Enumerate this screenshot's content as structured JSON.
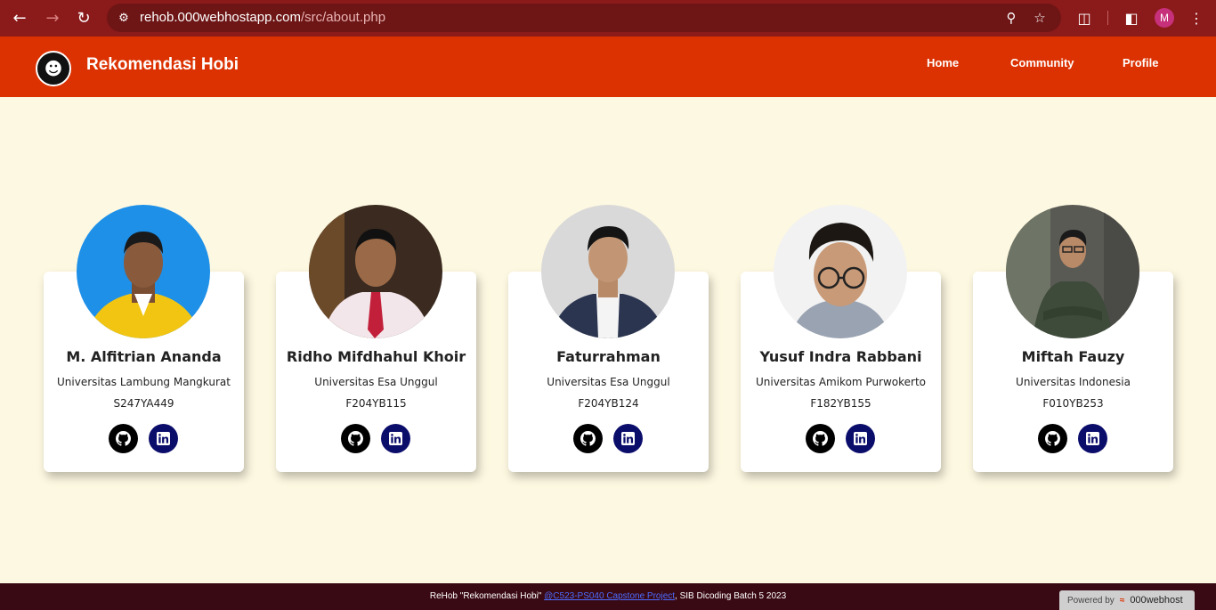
{
  "browser": {
    "url_host": "rehob.000webhostapp.com",
    "url_path": "/src/about.php",
    "profile_initial": "M"
  },
  "site": {
    "brand": "Rekomendasi Hobi",
    "nav": [
      {
        "label": "Home"
      },
      {
        "label": "Community"
      },
      {
        "label": "Profile"
      }
    ]
  },
  "team": [
    {
      "name": "M. Alfitrian Ananda",
      "university": "Universitas Lambung Mangkurat",
      "id": "S247YA449",
      "photo_bg": "#1e90e8"
    },
    {
      "name": "Ridho Mifdhahul Khoir",
      "university": "Universitas Esa Unggul",
      "id": "F204YB115",
      "photo_bg": "#3a2a1f"
    },
    {
      "name": "Faturrahman",
      "university": "Universitas Esa Unggul",
      "id": "F204YB124",
      "photo_bg": "#d9d9d9"
    },
    {
      "name": "Yusuf Indra Rabbani",
      "university": "Universitas Amikom Purwokerto",
      "id": "F182YB155",
      "photo_bg": "#f2f2f2"
    },
    {
      "name": "Miftah Fauzy",
      "university": "Universitas Indonesia",
      "id": "F010YB253",
      "photo_bg": "#5a5a55"
    }
  ],
  "footer": {
    "prefix": "ReHob \"Rekomendasi Hobi\" ",
    "link": "@C523-PS040 Capstone Project",
    "suffix": ", SIB Dicoding Batch 5 2023"
  },
  "badge": {
    "powered_by": "Powered by",
    "host": "000webhost"
  },
  "colors": {
    "header": "#dc3100",
    "background": "#fdf8e1",
    "footer": "#3a0a14",
    "linkedin": "#0b0d6b"
  }
}
